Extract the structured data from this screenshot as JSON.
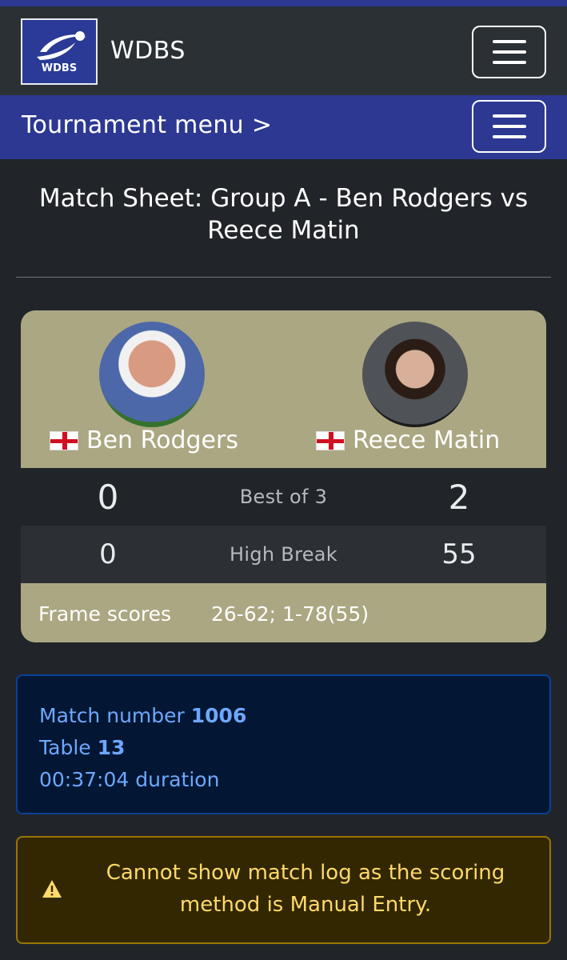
{
  "brand": {
    "name": "WDBS",
    "logo_text": "WDBS"
  },
  "tournament_nav": {
    "label": "Tournament menu >"
  },
  "page_title": "Match Sheet: Group A - Ben Rodgers vs Reece Matin",
  "match": {
    "player1": {
      "name": "Ben Rodgers",
      "frames": "0",
      "high_break": "0"
    },
    "player2": {
      "name": "Reece Matin",
      "frames": "2",
      "high_break": "55"
    },
    "format_label": "Best of 3",
    "high_break_label": "High Break",
    "frame_scores_label": "Frame scores",
    "frame_scores_value": "26-62; 1-78(55)"
  },
  "info": {
    "match_number_label": "Match number",
    "match_number": "1006",
    "table_label": "Table",
    "table": "13",
    "duration": "00:37:04 duration"
  },
  "alert": {
    "message": "Cannot show match log as the scoring method is Manual Entry."
  },
  "colors": {
    "background": "#212529",
    "navbar": "#2b3035",
    "tournament_bar": "#2c3891",
    "card": "#aba782",
    "info_bg": "#031633",
    "info_text": "#6ea8fe",
    "warn_bg": "#332701",
    "warn_text": "#ffda6a"
  },
  "icons": [
    "menu-icon",
    "england-flag-icon",
    "warning-icon"
  ]
}
